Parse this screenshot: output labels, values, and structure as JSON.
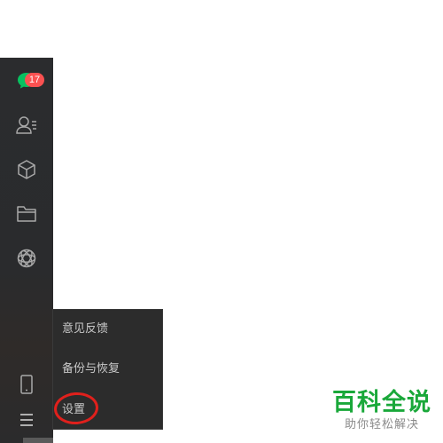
{
  "sidebar": {
    "chat_badge": "17",
    "icons": {
      "chat": "chat-bubble-icon",
      "contacts": "contacts-icon",
      "collections": "cube-icon",
      "files": "folder-icon",
      "moments": "aperture-icon",
      "phone": "phone-icon",
      "menu": "hamburger-menu-icon"
    }
  },
  "popup_menu": {
    "items": [
      "意见反馈",
      "备份与恢复",
      "设置"
    ]
  },
  "watermark": {
    "title": "百科全说",
    "subtitle": "助你轻松解决"
  },
  "colors": {
    "sidebar_bg": "#2b2c2e",
    "menu_bg": "#2c2c2c",
    "chat_green": "#07c160",
    "badge_red": "#fa5151",
    "highlight_red": "#e0201c",
    "watermark_green": "#1aa83a"
  }
}
